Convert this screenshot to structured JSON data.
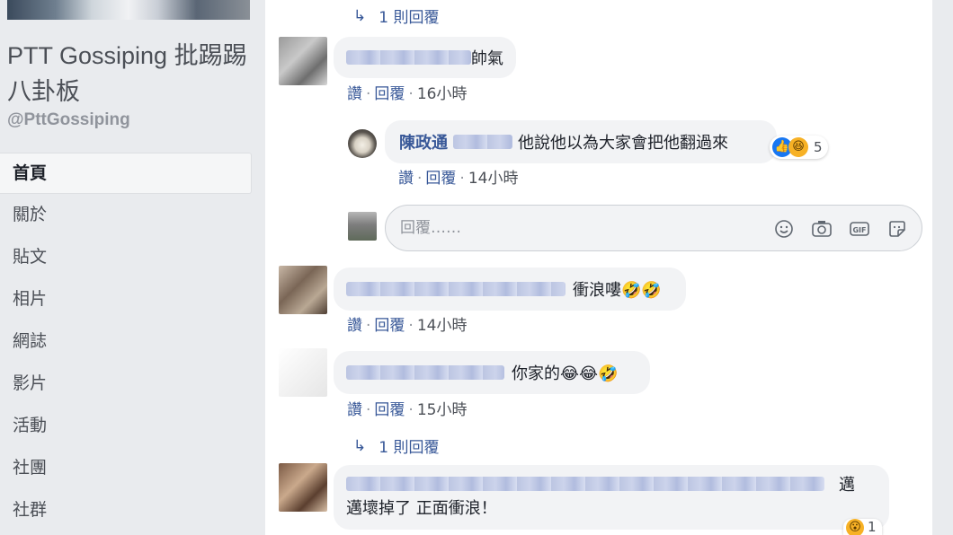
{
  "page": {
    "name": "PTT Gossiping 批踢踢八卦板",
    "handle": "@PttGossiping"
  },
  "nav": {
    "items": [
      {
        "label": "首頁"
      },
      {
        "label": "關於"
      },
      {
        "label": "貼文"
      },
      {
        "label": "相片"
      },
      {
        "label": "網誌"
      },
      {
        "label": "影片"
      },
      {
        "label": "活動"
      },
      {
        "label": "社團"
      },
      {
        "label": "社群"
      }
    ]
  },
  "comments": {
    "top_replies_link": "1 則回覆",
    "c1": {
      "text": "帥氣",
      "like": "讚",
      "reply": "回覆",
      "time": "16小時"
    },
    "r1": {
      "author": "陳政通",
      "text": "他說他以為大家會把他翻過來",
      "reaction_count": "5",
      "like": "讚",
      "reply": "回覆",
      "time": "14小時"
    },
    "reply_box": {
      "placeholder": "回覆……"
    },
    "c2": {
      "text": "衝浪嘍🤣🤣",
      "like": "讚",
      "reply": "回覆",
      "time": "14小時"
    },
    "c3": {
      "text": "你家的😂😂🤣",
      "like": "讚",
      "reply": "回覆",
      "time": "15小時"
    },
    "c3_replies_link": "1 則回覆",
    "c4": {
      "text_line1_end": "邁",
      "text_line2": "邁壞掉了 正面衝浪！",
      "reaction_count": "1"
    }
  },
  "colors": {
    "link": "#385898",
    "bubble": "#f2f3f5",
    "sidebar_bg": "#e9ebee"
  },
  "icons": {
    "reply_box": [
      "smiley-icon",
      "camera-icon",
      "gif-icon",
      "sticker-icon"
    ]
  }
}
